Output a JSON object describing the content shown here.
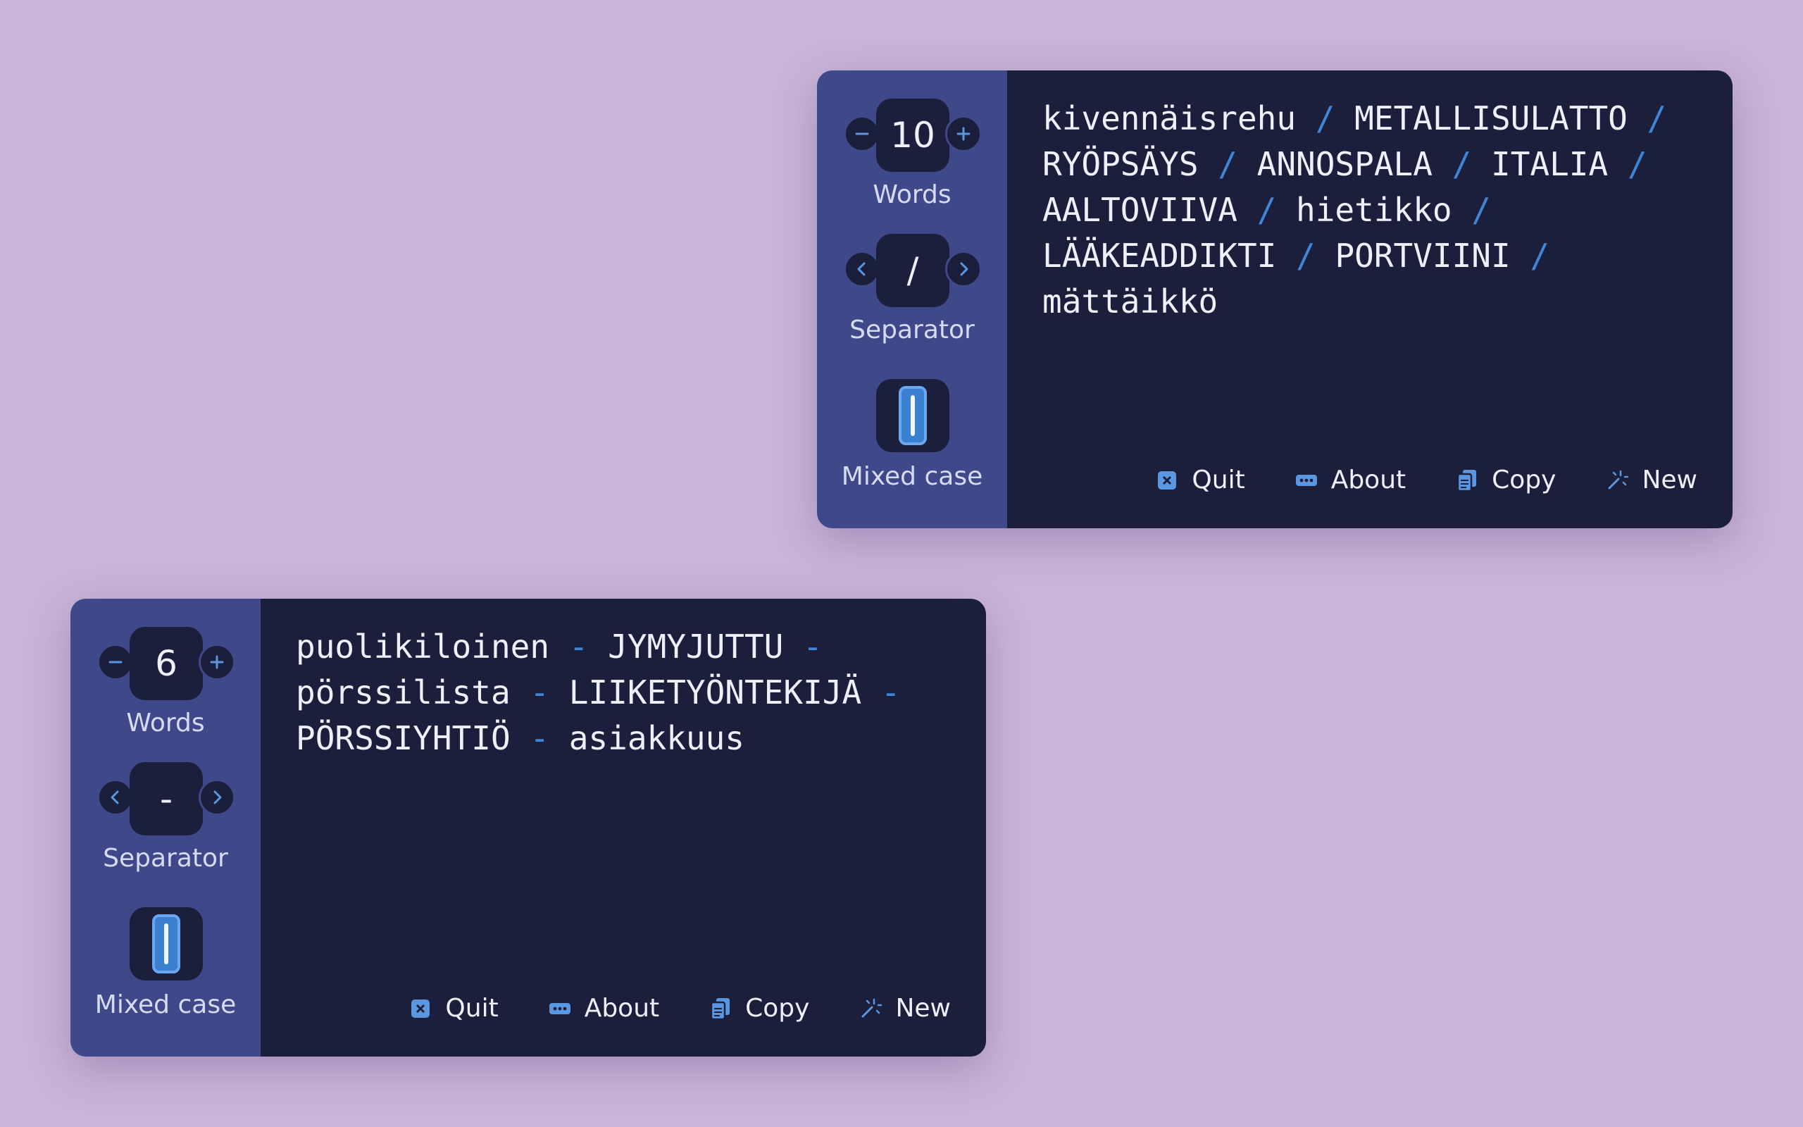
{
  "colors": {
    "background": "#c9b5d9",
    "sidebar": "#3f4889",
    "content": "#1c1f3b",
    "accent": "#3f85d8",
    "text": "#eef0fb"
  },
  "panels": [
    {
      "words": {
        "count": "10",
        "label": "Words"
      },
      "separator": {
        "value": "/",
        "label": "Separator"
      },
      "mixed_case": {
        "label": "Mixed case",
        "on": true
      },
      "passphrase": {
        "words": [
          "kivennäisrehu",
          "METALLISULATTO",
          "RYÖPSÄYS",
          "ANNOSPALA",
          "ITALIA",
          "AALTOVIIVA",
          "hietikko",
          "LÄÄKEADDIKTI",
          "PORTVIINI",
          "mättäikkö"
        ]
      },
      "actions": {
        "quit": "Quit",
        "about": "About",
        "copy": "Copy",
        "new": "New"
      }
    },
    {
      "words": {
        "count": "6",
        "label": "Words"
      },
      "separator": {
        "value": "-",
        "label": "Separator"
      },
      "mixed_case": {
        "label": "Mixed case",
        "on": true
      },
      "passphrase": {
        "words": [
          "puolikiloinen",
          "JYMYJUTTU",
          "pörssilista",
          "LIIKETYÖNTEKIJÄ",
          "PÖRSSIYHTIÖ",
          "asiakkuus"
        ]
      },
      "actions": {
        "quit": "Quit",
        "about": "About",
        "copy": "Copy",
        "new": "New"
      }
    }
  ]
}
